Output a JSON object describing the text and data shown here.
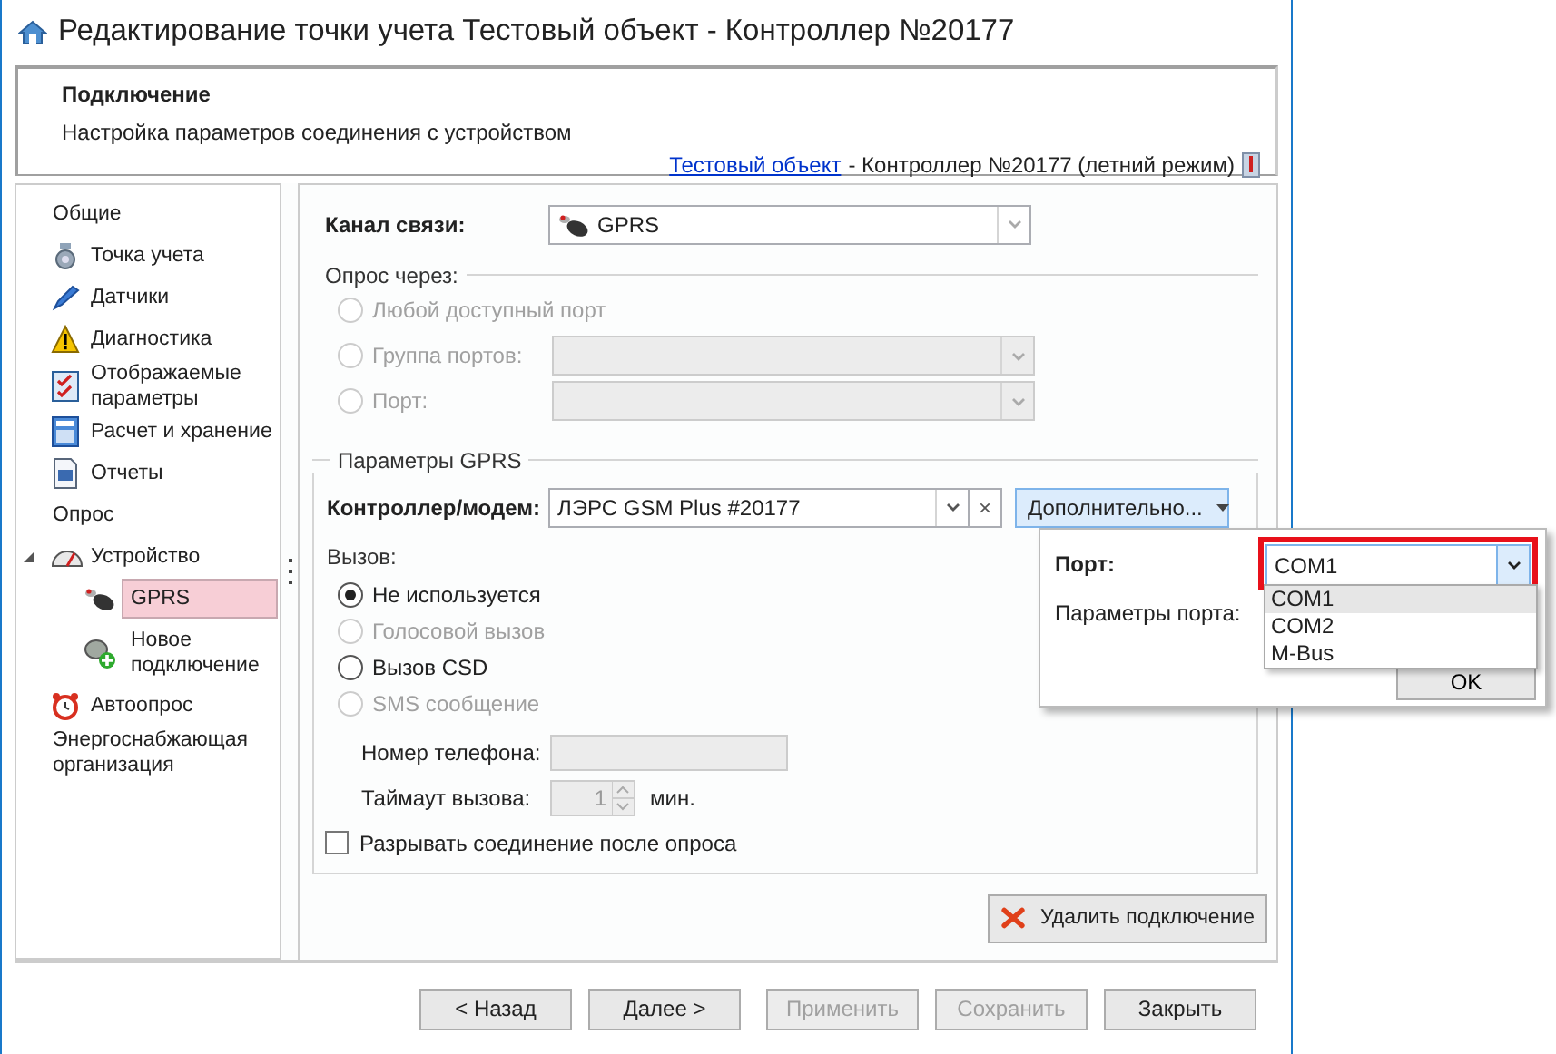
{
  "window": {
    "title": "Редактирование точки учета Тестовый объект - Контроллер №20177"
  },
  "header": {
    "title": "Подключение",
    "subtitle": "Настройка параметров соединения с устройством",
    "link": "Тестовый объект",
    "context": "- Контроллер №20177 (летний режим)"
  },
  "sidebar": {
    "items": [
      {
        "label": "Общие",
        "kind": "heading",
        "selected": false
      },
      {
        "label": "Точка учета",
        "kind": "item",
        "selected": false
      },
      {
        "label": "Датчики",
        "kind": "item",
        "selected": false
      },
      {
        "label": "Диагностика",
        "kind": "item",
        "selected": false
      },
      {
        "label": "Отображаемые параметры",
        "kind": "item",
        "selected": false
      },
      {
        "label": "Расчет и хранение",
        "kind": "item",
        "selected": false
      },
      {
        "label": "Отчеты",
        "kind": "item",
        "selected": false
      },
      {
        "label": "Опрос",
        "kind": "heading",
        "selected": false
      },
      {
        "label": "Устройство",
        "kind": "item",
        "selected": false,
        "expanded": true,
        "children": [
          {
            "label": "GPRS",
            "selected": true
          },
          {
            "label": "Новое подключение",
            "selected": false
          }
        ]
      },
      {
        "label": "Автоопрос",
        "kind": "item",
        "selected": false
      },
      {
        "label": "Энергоснабжающая организация",
        "kind": "heading",
        "selected": false
      }
    ]
  },
  "channel": {
    "label": "Канал связи:",
    "value": "GPRS"
  },
  "poll_via": {
    "legend": "Опрос через:",
    "options": [
      {
        "label": "Любой доступный порт",
        "kind": "radio",
        "selected": false,
        "disabled": true
      },
      {
        "label": "Группа портов:",
        "kind": "radio-combo",
        "selected": false,
        "disabled": true
      },
      {
        "label": "Порт:",
        "kind": "radio-combo",
        "selected": false,
        "disabled": true
      }
    ]
  },
  "gprs": {
    "legend": "Параметры GPRS",
    "modem_label": "Контроллер/модем:",
    "modem_value": "ЛЭРС GSM Plus #20177",
    "clear": "×",
    "more_button": "Дополнительно...",
    "call_legend": "Вызов:",
    "call_options": [
      {
        "label": "Не используется",
        "selected": true,
        "disabled": false
      },
      {
        "label": "Голосовой вызов",
        "selected": false,
        "disabled": true
      },
      {
        "label": "Вызов CSD",
        "selected": false,
        "disabled": false
      },
      {
        "label": "SMS сообщение",
        "selected": false,
        "disabled": true
      }
    ],
    "phone_label": "Номер телефона:",
    "timeout_label": "Таймаут вызова:",
    "timeout_value": "1",
    "timeout_unit": "мин.",
    "disconnect": {
      "label": "Разрывать соединение после опроса",
      "checked": false
    }
  },
  "delete_button": "Удалить подключение",
  "buttons": [
    {
      "label": "< Назад",
      "disabled": false
    },
    {
      "label": "Далее >",
      "disabled": false
    },
    {
      "label": "Применить",
      "disabled": true
    },
    {
      "label": "Сохранить",
      "disabled": true
    },
    {
      "label": "Закрыть",
      "disabled": false
    }
  ],
  "popup": {
    "port_label": "Порт:",
    "port_value": "COM1",
    "params_label": "Параметры порта:",
    "ok": "OK",
    "options": [
      {
        "label": "COM1",
        "selected": true
      },
      {
        "label": "COM2",
        "selected": false
      },
      {
        "label": "M-Bus",
        "selected": false
      }
    ]
  }
}
